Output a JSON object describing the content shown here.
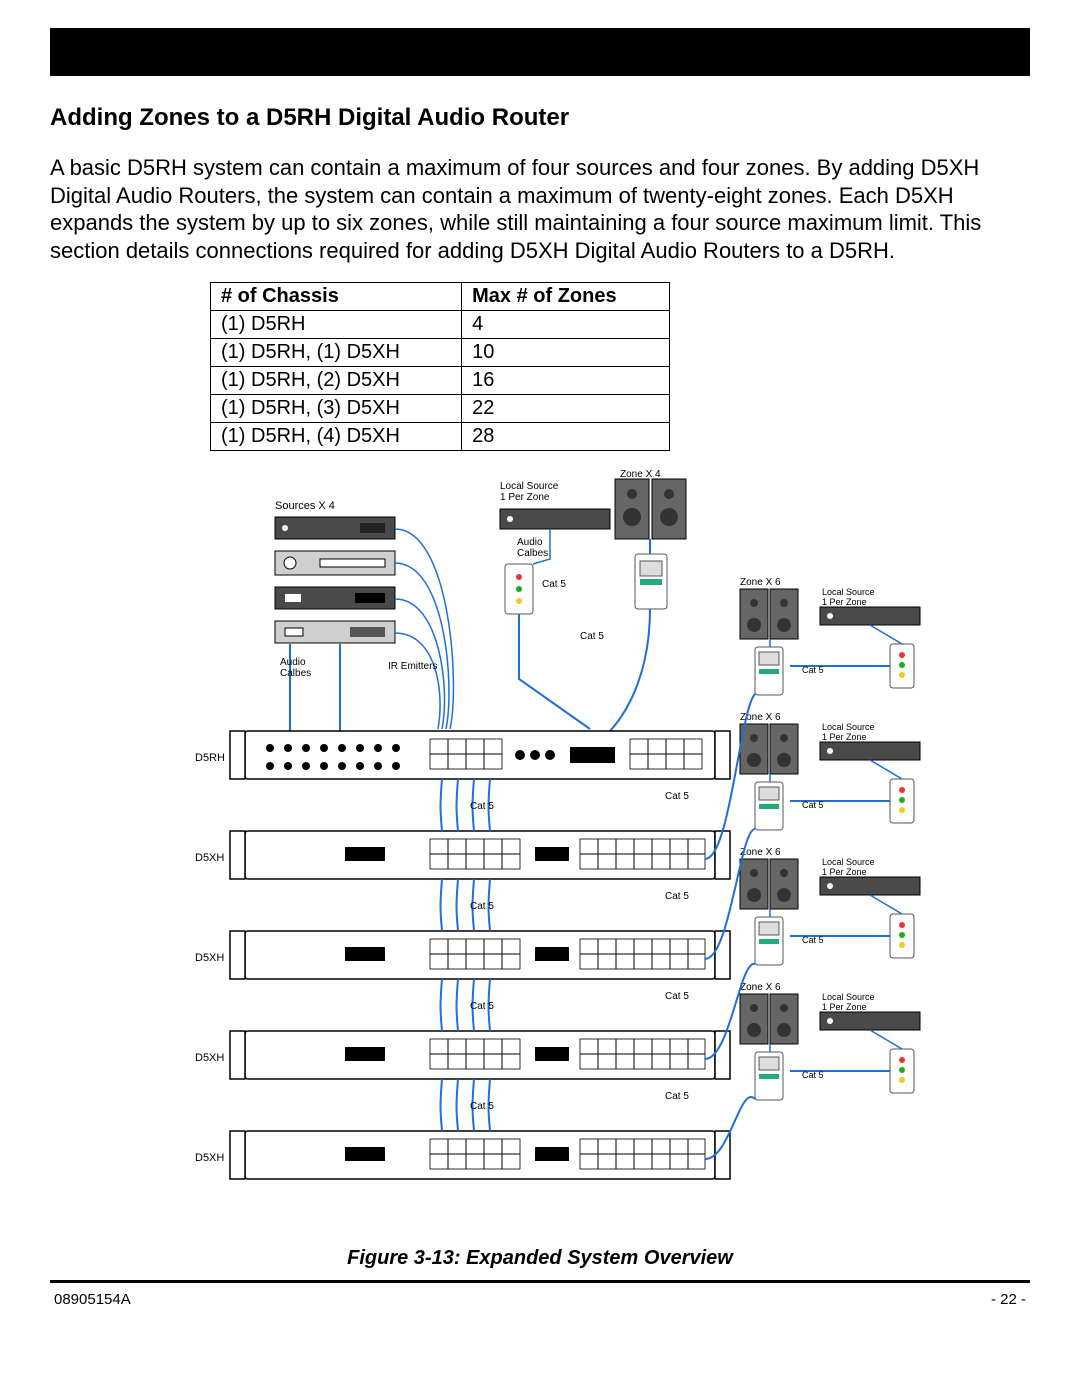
{
  "header": {
    "title": "Adding Zones to a D5RH Digital Audio Router"
  },
  "body": {
    "paragraph": "A basic D5RH system can contain a maximum of four sources and four zones. By adding D5XH Digital Audio Routers, the system can contain a maximum of twenty-eight zones. Each D5XH expands the system by up to six zones, while still maintaining a four source maximum limit. This section details connections required for adding D5XH Digital Audio Routers to a D5RH."
  },
  "table": {
    "headers": [
      "# of Chassis",
      "Max # of Zones"
    ],
    "rows": [
      [
        "(1) D5RH",
        "4"
      ],
      [
        "(1) D5RH, (1) D5XH",
        "10"
      ],
      [
        "(1) D5RH, (2) D5XH",
        "16"
      ],
      [
        "(1) D5RH, (3) D5XH",
        "22"
      ],
      [
        "(1) D5RH, (4) D5XH",
        "28"
      ]
    ]
  },
  "figure": {
    "caption": "Figure 3-13: Expanded System Overview",
    "labels": {
      "sources": "Sources X 4",
      "audio_cables_left": "Audio\nCalbes",
      "audio_cables_mid": "Audio\nCalbes",
      "ir_emitters": "IR Emitters",
      "local_source_top": "Local Source\n1 Per Zone",
      "zone_x4": "Zone X 4",
      "cat5": "Cat 5",
      "zone_x6": "Zone X 6",
      "local_source": "Local Source\n1 Per Zone"
    },
    "chassis_labels": [
      "D5RH",
      "D5XH",
      "D5XH",
      "D5XH",
      "D5XH"
    ]
  },
  "footer": {
    "doc_id": "08905154A",
    "page_no": "- 22 -"
  }
}
